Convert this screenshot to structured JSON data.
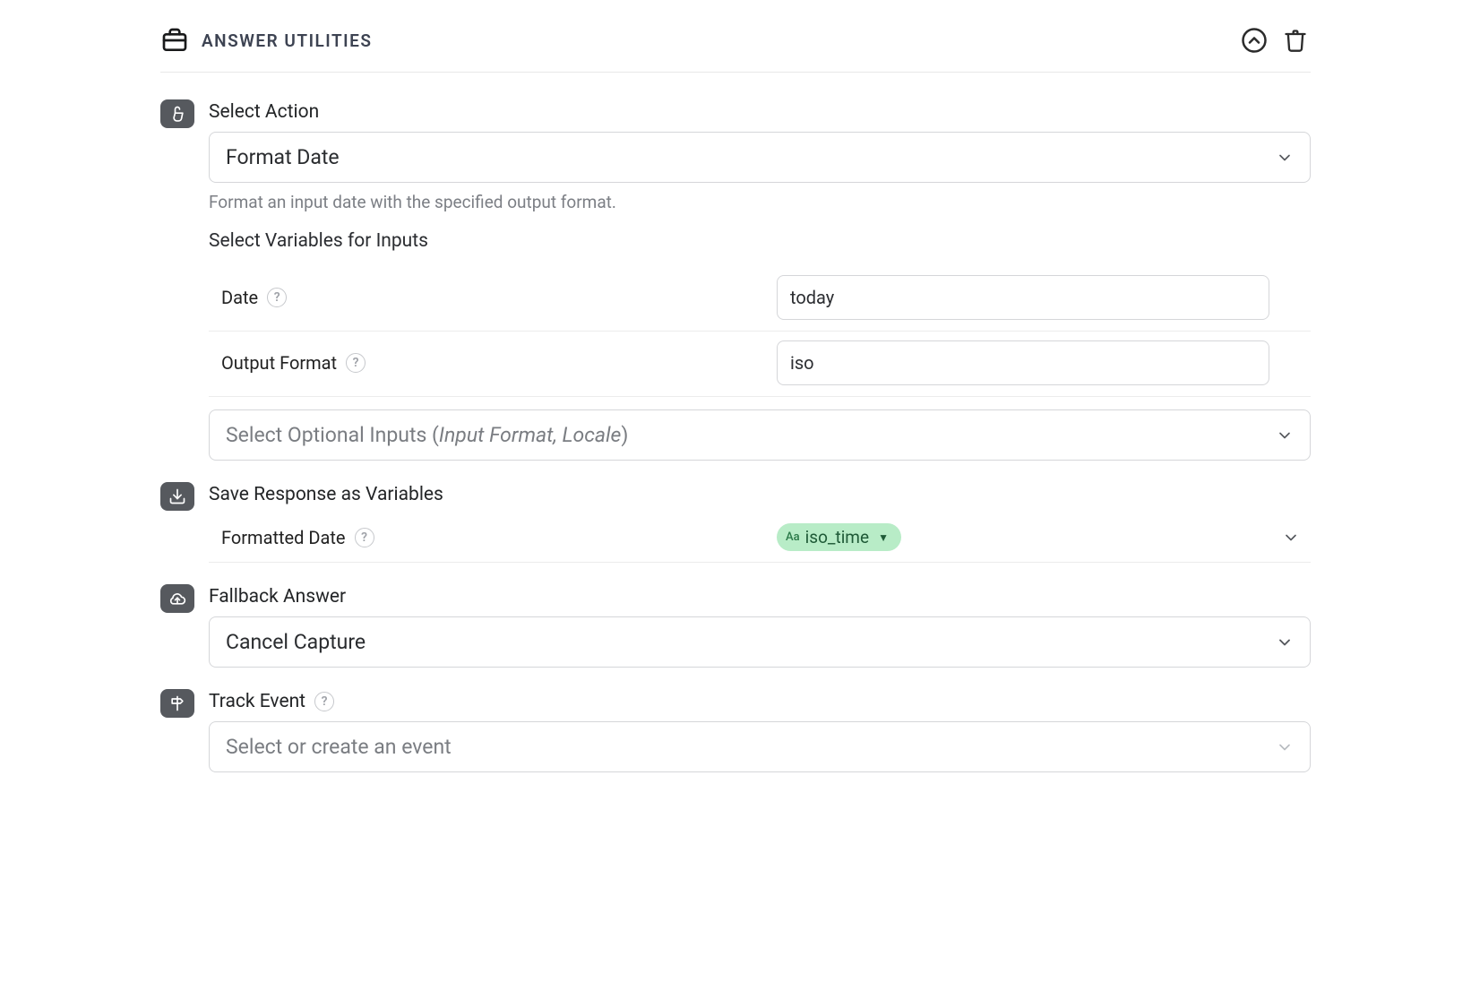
{
  "header": {
    "title": "ANSWER UTILITIES"
  },
  "action": {
    "label": "Select Action",
    "value": "Format Date",
    "description": "Format an input date with the specified output format."
  },
  "inputs": {
    "heading": "Select Variables for Inputs",
    "date_label": "Date",
    "date_value": "today",
    "output_format_label": "Output Format",
    "output_format_value": "iso",
    "optional_prefix": "Select Optional Inputs (",
    "optional_italic": "Input Format, Locale",
    "optional_suffix": ")"
  },
  "save": {
    "label": "Save Response as Variables",
    "formatted_date_label": "Formatted Date",
    "chip_value": "iso_time"
  },
  "fallback": {
    "label": "Fallback Answer",
    "value": "Cancel Capture"
  },
  "track": {
    "label": "Track Event",
    "placeholder": "Select or create an event"
  }
}
